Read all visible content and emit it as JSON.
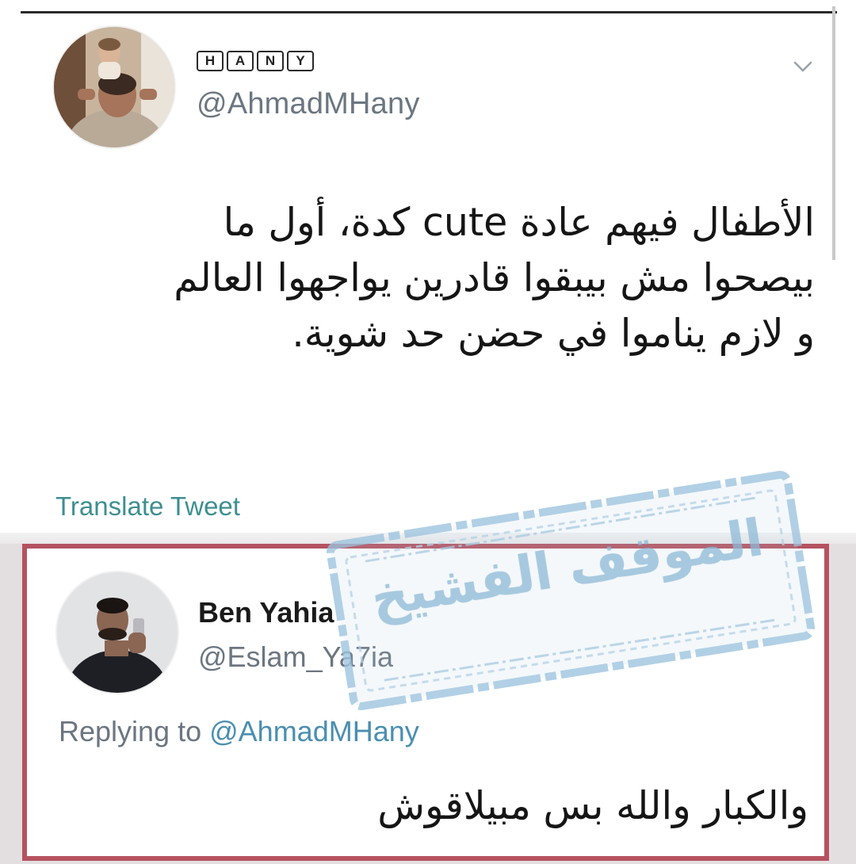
{
  "tweet": {
    "author_name_letters": [
      "H",
      "A",
      "N",
      "Y"
    ],
    "handle": "@AhmadMHany",
    "text_lines": [
      "الأطفال فيهم عادة cute كدة، أول ما",
      "بيصحوا مش بيبقوا قادرين يواجهوا العالم",
      "و لازم يناموا في حضن حد شوية."
    ],
    "translate_label": "Translate Tweet"
  },
  "reply": {
    "author_name": "Ben Yahia",
    "handle": "@Eslam_Ya7ia",
    "replying_prefix": "Replying to ",
    "replying_to": "@AhmadMHany",
    "text": "والكبار والله بس مبيلاقوش"
  },
  "watermark": {
    "text": "الموقف الفشيخ"
  },
  "colors": {
    "link": "#3e8f90",
    "mention": "#4a8fb0",
    "reply_border": "#b5525f",
    "watermark": "#8fbad7",
    "handle_gray": "#6b7680"
  }
}
